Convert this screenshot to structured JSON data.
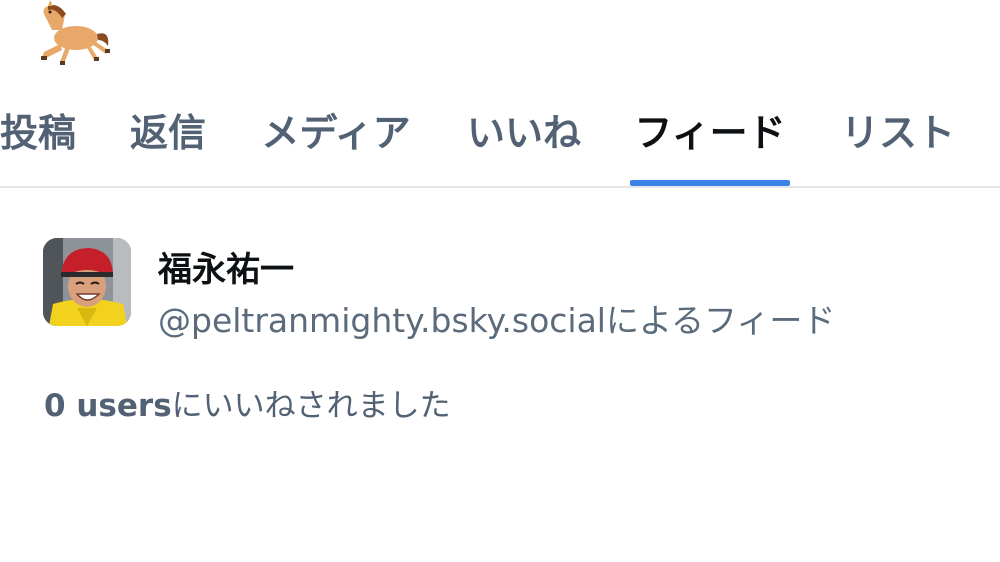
{
  "header": {
    "emoji_icon": "horse-emoji"
  },
  "tabs": [
    {
      "label": "投稿",
      "active": false
    },
    {
      "label": "返信",
      "active": false
    },
    {
      "label": "メディア",
      "active": false
    },
    {
      "label": "いいね",
      "active": false
    },
    {
      "label": "フィード",
      "active": true
    },
    {
      "label": "リスト",
      "active": false
    }
  ],
  "colors": {
    "accent": "#3b82e8",
    "tab_inactive": "#526274",
    "tab_active": "#0e1114",
    "divider": "#e3e6ea"
  },
  "feed": {
    "title": "福永祐一",
    "creator_line": "@peltranmighty.bsky.socialによるフィード",
    "likes_count": "0 users",
    "likes_suffix": "にいいねされました",
    "avatar_icon": "jockey-avatar"
  }
}
